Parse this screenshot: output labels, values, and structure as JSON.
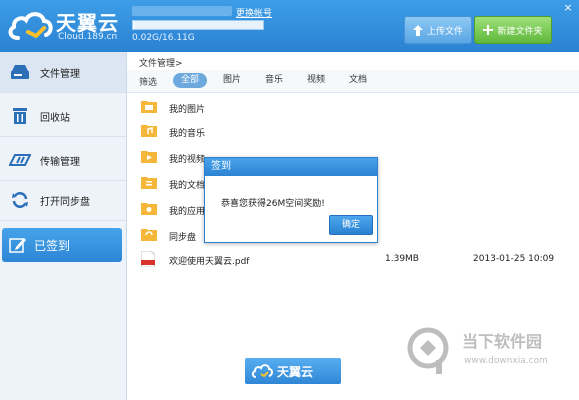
{
  "app": {
    "logo_title": "天翼云",
    "logo_sub": "Cloud.189.cn",
    "switch_account": "更换帐号",
    "quota_text": "0.02G/16.11G",
    "quota_fraction": 0.0012,
    "upload_label": "上传文件",
    "new_folder_label": "新建文件夹",
    "close": "×"
  },
  "sidebar": {
    "items": [
      {
        "label": "文件管理",
        "icon": "drive-icon"
      },
      {
        "label": "回收站",
        "icon": "trash-icon"
      },
      {
        "label": "传输管理",
        "icon": "transfer-icon"
      },
      {
        "label": "打开同步盘",
        "icon": "sync-icon"
      }
    ],
    "signed_label": "已签到"
  },
  "main": {
    "breadcrumb": "文件管理>",
    "filter_label": "筛选",
    "tabs": [
      "全部",
      "图片",
      "音乐",
      "视频",
      "文档"
    ],
    "files": [
      {
        "name": "我的图片",
        "icon": "folder-picture-icon",
        "size": "",
        "date": ""
      },
      {
        "name": "我的音乐",
        "icon": "folder-music-icon",
        "size": "",
        "date": ""
      },
      {
        "name": "我的视频",
        "icon": "folder-video-icon",
        "size": "",
        "date": ""
      },
      {
        "name": "我的文档",
        "icon": "folder-document-icon",
        "size": "",
        "date": ""
      },
      {
        "name": "我的应用",
        "icon": "folder-app-icon",
        "size": "",
        "date": ""
      },
      {
        "name": "同步盘",
        "icon": "folder-sync-icon",
        "size": "",
        "date": ""
      },
      {
        "name": "欢迎使用天翼云.pdf",
        "icon": "pdf-icon",
        "size": "1.39MB",
        "date": "2013-01-25 10:09"
      }
    ],
    "bottom_logo": "天翼云"
  },
  "dialog": {
    "title": "签到",
    "message": "恭喜您获得26M空间奖励!",
    "ok_label": "确定"
  },
  "watermark": {
    "title": "当下软件园",
    "url": "www.downxia.com"
  },
  "colors": {
    "header": "#2a82d3",
    "accent": "#3e9de6",
    "green": "#5fb83b"
  }
}
